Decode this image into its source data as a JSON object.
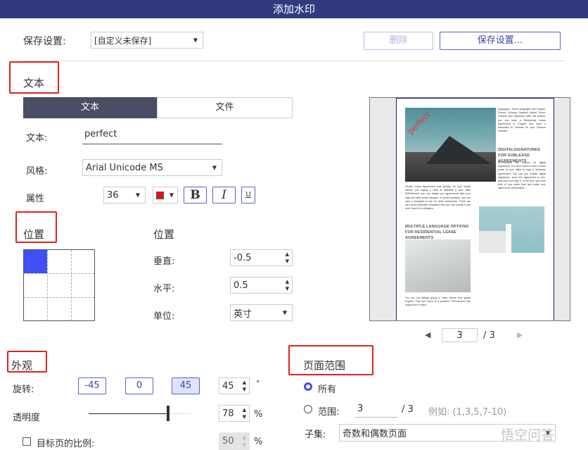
{
  "window": {
    "title": "添加水印"
  },
  "save_settings": {
    "label": "保存设置:",
    "selected": "[自定义未保存]",
    "delete_label": "删除",
    "save_label": "保存设置..."
  },
  "text_section": {
    "title": "文本",
    "tabs": [
      {
        "label": "文本",
        "active": true
      },
      {
        "label": "文件",
        "active": false
      }
    ],
    "text_label": "文本:",
    "text_value": "perfect",
    "style_label": "风格:",
    "font_value": "Arial Unicode MS",
    "attr_label": "属性",
    "font_size": "36",
    "color": "#e81010",
    "bold_label": "B",
    "italic_label": "I",
    "underline_label": "U"
  },
  "position_section": {
    "title": "位置",
    "subtitle": "位置",
    "selected_cell": "top-left",
    "vertical_label": "垂直:",
    "vertical_value": "-0.5",
    "horizontal_label": "水平:",
    "horizontal_value": "0.5",
    "unit_label": "单位:",
    "unit_value": "英寸"
  },
  "appearance_section": {
    "title": "外观",
    "rotation_label": "旋转:",
    "rotation_presets": [
      "-45",
      "0",
      "45"
    ],
    "rotation_active": "45",
    "rotation_value": "45",
    "degree_unit": "°",
    "opacity_label": "透明度",
    "opacity_value": "78",
    "percent": "%",
    "scale_label": "目标页的比例:",
    "scale_checked": false,
    "scale_value": "50"
  },
  "page_range": {
    "title": "页面范围",
    "all_label": "所有",
    "all_selected": true,
    "range_label": "范围:",
    "range_value": "3",
    "range_total": "/  3",
    "example": "例如:  (1,3,5,7-10)",
    "subset_label": "子集:",
    "subset_value": "奇数和偶数页面"
  },
  "preview": {
    "watermark": "perfect",
    "current_page": "3",
    "total_pages": "/ 3",
    "p1": "languages. These languages are English, French, German, Spanish, Italian, Dutch, Chinese and Japanese. With this feature, you can write a Residential Lease Agreement in English and have it translated to Chinese for your Chinese clientele.",
    "h1": "DIGITALSIGNATURES FOR SUBLEASE AGREEMENTS",
    "p2": "PDFelement has options for digital signatures. You don't need to have a client come to your office to sign a Sublease Agreement. You can just enable digital signatures, send the agreement to him, and have him sign it. In the end, you save both of you some time and make your client more comfortable.",
    "p3": "Rental Lease Agreement that speaks for your brand without you saying a word is definitely a plus. With PDFelement, you can design you agreements with your logo and other brand designs. To avoid repetition, you can save a template to use for other documents. There are also some premade templates that you can modify if you aren't much of a designer.",
    "h2": "MULTIPLE LANGUAGE OPTIONS FOR RESIDENTIAL LEASE AGREEMENTS",
    "p4": "You are not always going to have clients that speak English. This isn't much of a problem. PDFelement has support for 9 major"
  },
  "watermark_logo": "悟空问答",
  "colors": {
    "titlebar": "#313a7f",
    "accent": "#3f51f5",
    "active_tab": "#4a4d66",
    "highlight": "#e0231c"
  }
}
